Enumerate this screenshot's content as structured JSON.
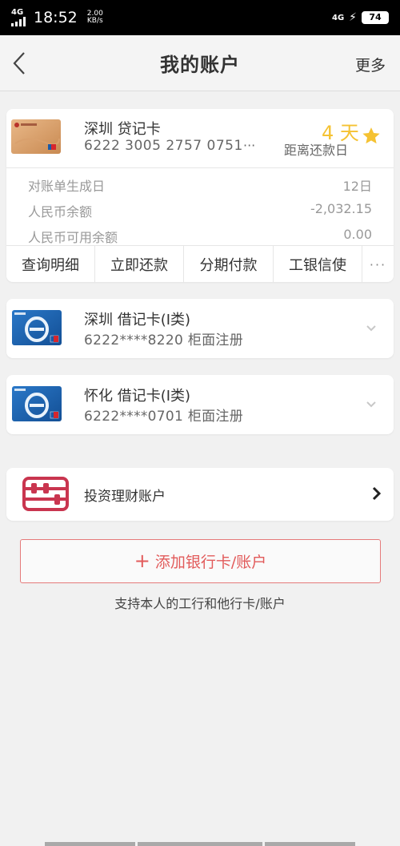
{
  "status_bar": {
    "network_left": "4G",
    "time": "18:52",
    "speed_value": "2.00",
    "speed_unit": "KB/s",
    "network_right": "4G",
    "battery": "74"
  },
  "header": {
    "title": "我的账户",
    "more_label": "更多"
  },
  "credit_card": {
    "name": "深圳 贷记卡",
    "number": "6222 3005 2757 0751",
    "ellipsis": "···",
    "due_days": "4 天",
    "due_label": "距离还款日",
    "rows": [
      {
        "label": "对账单生成日",
        "value": "12日"
      },
      {
        "label": "人民币余额",
        "value": "-2,032.15"
      },
      {
        "label": "人民币可用余额",
        "value": "0.00"
      }
    ],
    "actions": [
      "查询明细",
      "立即还款",
      "分期付款",
      "工银信使"
    ],
    "actions_more": "···"
  },
  "debit_cards": [
    {
      "name": "深圳 借记卡(Ⅰ类)",
      "number": "6222****8220   柜面注册"
    },
    {
      "name": "怀化 借记卡(Ⅰ类)",
      "number": "6222****0701   柜面注册"
    }
  ],
  "wealth": {
    "label": "投资理财账户"
  },
  "add_card": {
    "plus": "+",
    "label": "添加银行卡/账户",
    "hint": "支持本人的工行和他行卡/账户"
  },
  "colors": {
    "accent_red": "#e25b5b",
    "gold": "#f5c232",
    "abacus": "#c9354f"
  },
  "icons": [
    "back-icon",
    "star-icon",
    "chevron-down-icon",
    "abacus-icon",
    "chevron-right-icon",
    "plus-icon"
  ]
}
